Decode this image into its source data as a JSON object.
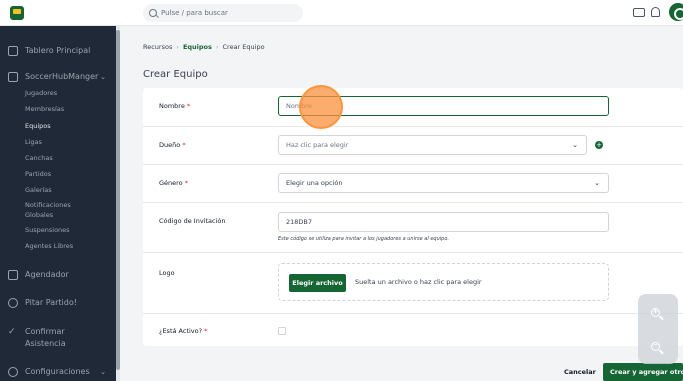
{
  "search": {
    "placeholder": "Pulse / para buscar"
  },
  "sidebar": {
    "dashboard": "Tablero Principal",
    "org": "SoccerHubManger",
    "items": [
      {
        "label": "Jugadores"
      },
      {
        "label": "Membresías"
      },
      {
        "label": "Equipos"
      },
      {
        "label": "Ligas"
      },
      {
        "label": "Canchas"
      },
      {
        "label": "Partidos"
      },
      {
        "label": "Galerías"
      },
      {
        "label": "Notificaciones"
      },
      {
        "label": "Globales"
      },
      {
        "label": "Suspensiones"
      },
      {
        "label": "Agentes Libres"
      }
    ],
    "scheduler": "Agendador",
    "whistle": "Pitar Partido!",
    "confirm_1": "Confirmar",
    "confirm_2": "Asistencia",
    "settings": "Configuraciones"
  },
  "breadcrumb": {
    "root": "Recursos",
    "section": "Equipos",
    "current": "Crear Equipo"
  },
  "page": {
    "title": "Crear Equipo"
  },
  "form": {
    "name": {
      "label": "Nombre",
      "required": "*",
      "placeholder": "Nombre"
    },
    "owner": {
      "label": "Dueño",
      "required": "*",
      "placeholder": "Haz clic para elegir"
    },
    "gender": {
      "label": "Género",
      "required": "*",
      "placeholder": "Elegir una opción"
    },
    "invite": {
      "label": "Código de Invitación",
      "value": "218DB7",
      "help": "Este código se utiliza para invitar a los jugadores a unirse al equipo."
    },
    "logo": {
      "label": "Logo",
      "button": "Elegir archivo",
      "drop_text": "Suelta un archivo o haz clic para elegir"
    },
    "active": {
      "label": "¿Está Activo?",
      "required": "*",
      "checked": false
    }
  },
  "actions": {
    "cancel": "Cancelar",
    "submit": "Crear y agregar otro"
  },
  "colors": {
    "brand": "#166534",
    "sidebar": "#1f2937",
    "required": "#dc2626"
  },
  "icons": [
    "search-icon",
    "monitor-icon",
    "bell-icon",
    "power-icon",
    "zoom-in-icon",
    "zoom-out-icon"
  ]
}
